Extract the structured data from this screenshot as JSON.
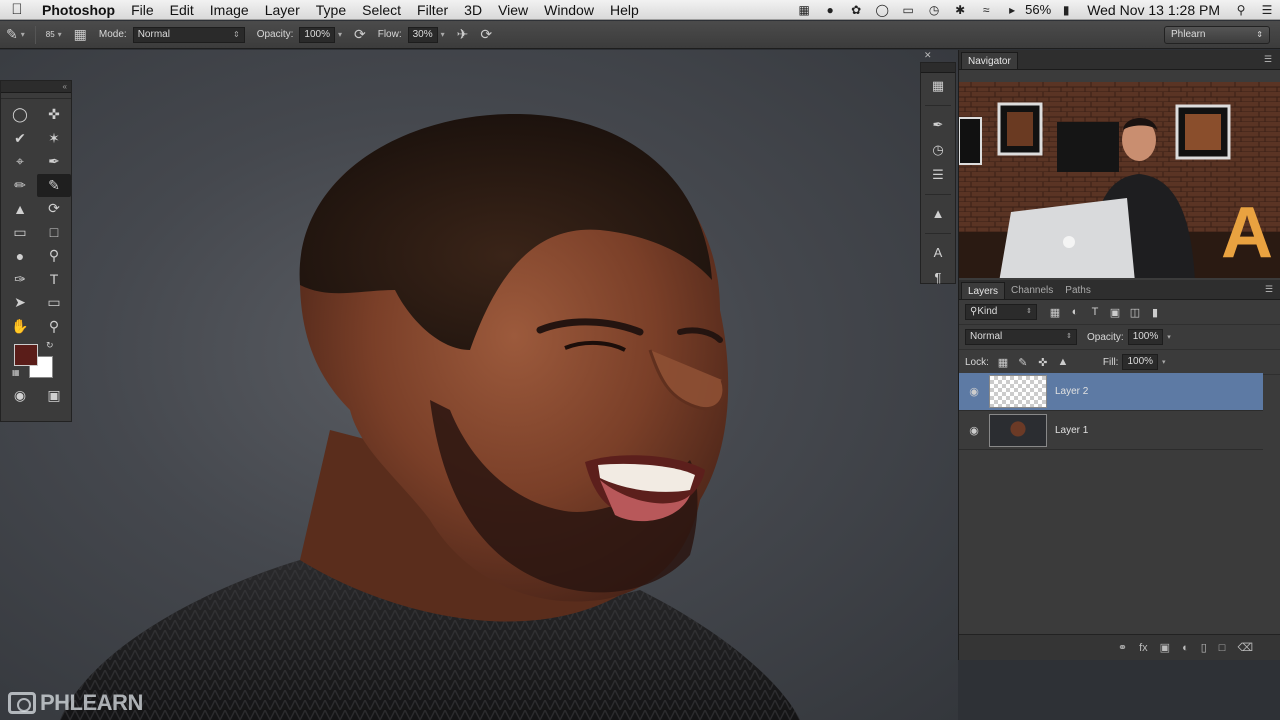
{
  "menubar": {
    "app_name": "Photoshop",
    "menus": [
      "File",
      "Edit",
      "Image",
      "Layer",
      "Type",
      "Select",
      "Filter",
      "3D",
      "View",
      "Window",
      "Help"
    ],
    "battery": "56%",
    "clock": "Wed Nov 13  1:28 PM"
  },
  "options_bar": {
    "brush_size": "85",
    "mode_label": "Mode:",
    "mode_value": "Normal",
    "opacity_label": "Opacity:",
    "opacity_value": "100%",
    "flow_label": "Flow:",
    "flow_value": "30%",
    "workspace": "Phlearn"
  },
  "navigator": {
    "tab": "Navigator"
  },
  "layers_panel": {
    "tabs": [
      "Layers",
      "Channels",
      "Paths"
    ],
    "kind_label": "Kind",
    "blend_mode": "Normal",
    "opacity_label": "Opacity:",
    "opacity_value": "100%",
    "lock_label": "Lock:",
    "fill_label": "Fill:",
    "fill_value": "100%",
    "layers": [
      {
        "name": "Layer 2",
        "selected": true
      },
      {
        "name": "Layer 1",
        "selected": false
      }
    ]
  },
  "watermark": "PHLEARN",
  "colors": {
    "foreground": "#5a1d19",
    "background": "#ffffff",
    "selection": "#5d7aa4"
  }
}
